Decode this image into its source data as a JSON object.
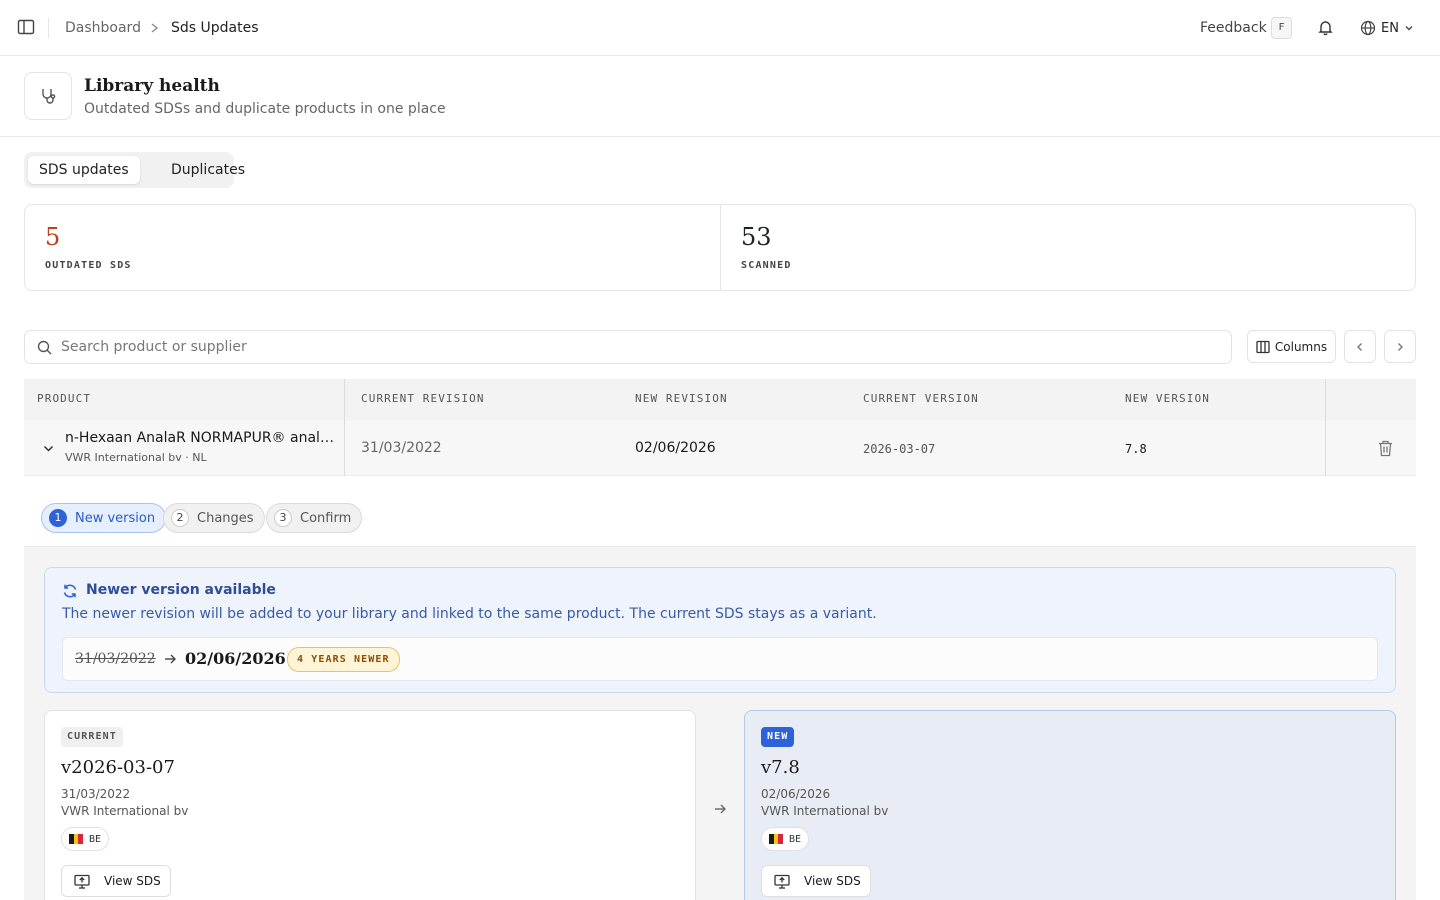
{
  "topbar": {
    "breadcrumb": [
      "Dashboard",
      "Sds Updates"
    ],
    "feedback": "Feedback",
    "feedback_shortcut": "F",
    "language": "EN"
  },
  "header": {
    "title": "Library health",
    "subtitle": "Outdated SDSs and duplicate products in one place"
  },
  "tabs": [
    "SDS updates",
    "Duplicates"
  ],
  "stats": [
    {
      "value": "5",
      "label": "OUTDATED SDS",
      "color": "#b8431f"
    },
    {
      "value": "53",
      "label": "SCANNED",
      "color": "#1a1a1a"
    }
  ],
  "toolbar": {
    "search_placeholder": "Search product or supplier",
    "columns_label": "Columns"
  },
  "table": {
    "headers": [
      "PRODUCT",
      "CURRENT REVISION",
      "NEW REVISION",
      "CURRENT VERSION",
      "NEW VERSION"
    ],
    "row": {
      "product": "n-Hexaan AnalaR NORMAPUR® analytical reagent",
      "supplier": "VWR International bv · NL",
      "current_revision": "31/03/2022",
      "new_revision": "02/06/2026",
      "current_version": "2026-03-07",
      "new_version": "7.8"
    }
  },
  "steps": [
    {
      "num": "1",
      "label": "New version"
    },
    {
      "num": "2",
      "label": "Changes"
    },
    {
      "num": "3",
      "label": "Confirm"
    }
  ],
  "notice": {
    "title": "Newer version available",
    "body": "The newer revision will be added to your library and linked to the same product. The current SDS stays as a variant.",
    "old_date": "31/03/2022",
    "new_date": "02/06/2026",
    "badge": "4 YEARS NEWER"
  },
  "current_card": {
    "tag": "CURRENT",
    "version": "v2026-03-07",
    "date": "31/03/2022",
    "supplier": "VWR International bv",
    "country": "BE",
    "button": "View SDS"
  },
  "new_card": {
    "tag": "NEW",
    "version": "v7.8",
    "date": "02/06/2026",
    "supplier": "VWR International bv",
    "country": "BE",
    "button": "View SDS"
  },
  "colors": {
    "accent": "#2e62d9",
    "outdated": "#b8431f",
    "flag_be": [
      "#1a1a1a",
      "#f5c518",
      "#d7263d"
    ]
  }
}
